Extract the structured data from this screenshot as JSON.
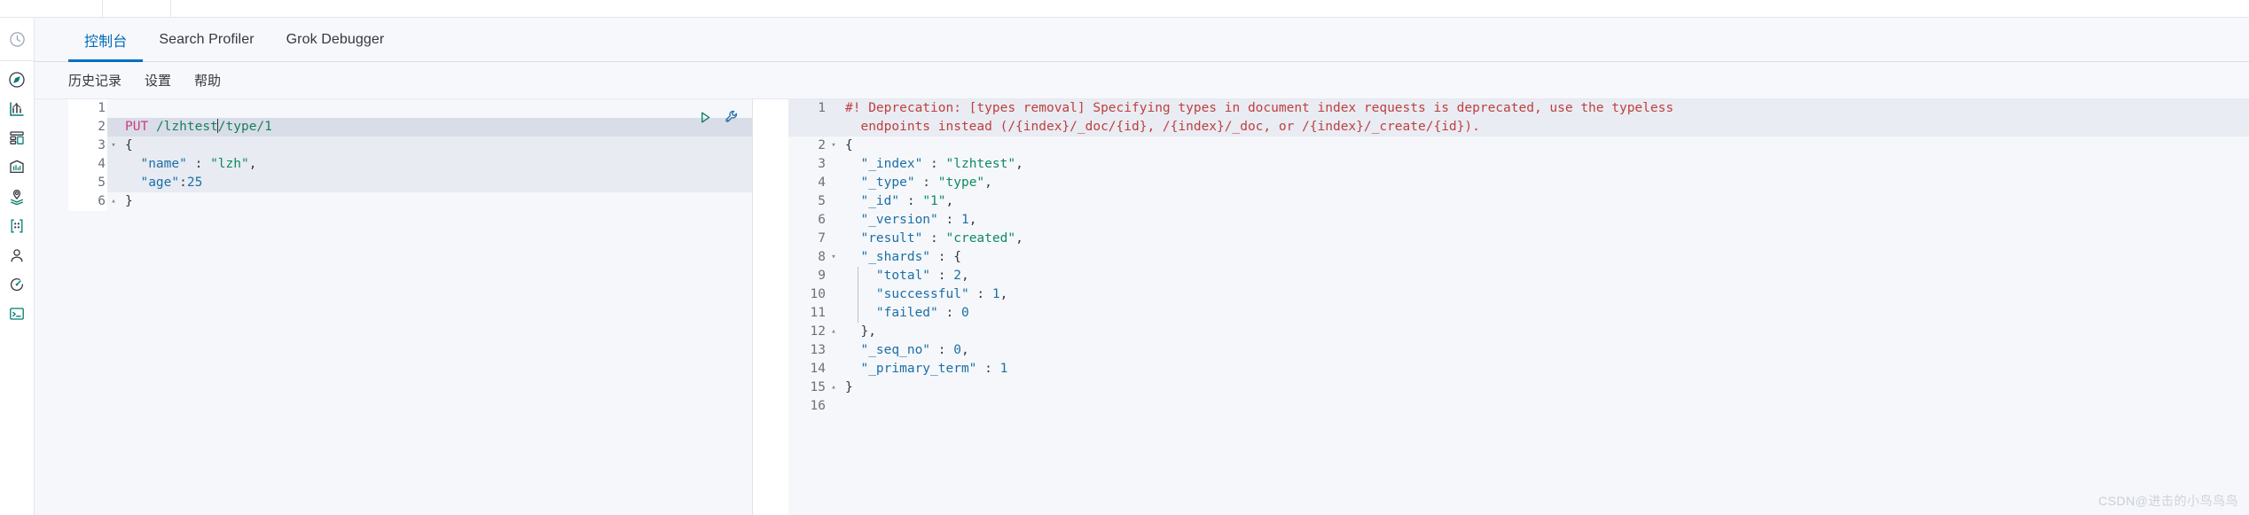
{
  "sidebar": {
    "items": [
      {
        "name": "recently-viewed",
        "icon": "clock-icon"
      },
      {
        "name": "discover",
        "icon": "compass-icon"
      },
      {
        "name": "visualize",
        "icon": "chart-icon"
      },
      {
        "name": "dashboard",
        "icon": "dashboard-icon"
      },
      {
        "name": "canvas",
        "icon": "canvas-icon"
      },
      {
        "name": "maps",
        "icon": "map-pin-layers-icon"
      },
      {
        "name": "machine-learning",
        "icon": "ml-nodes-icon"
      },
      {
        "name": "infrastructure",
        "icon": "user-icon"
      },
      {
        "name": "apm",
        "icon": "apm-icon"
      },
      {
        "name": "dev-tools",
        "icon": "wrench-terminal-icon"
      }
    ]
  },
  "tabs": [
    {
      "label": "控制台",
      "active": true
    },
    {
      "label": "Search Profiler",
      "active": false
    },
    {
      "label": "Grok Debugger",
      "active": false
    }
  ],
  "menu": [
    {
      "label": "历史记录"
    },
    {
      "label": "设置"
    },
    {
      "label": "帮助"
    }
  ],
  "editor": {
    "actions": {
      "run_label": "▷",
      "wrench_label": "wrench"
    },
    "lines": [
      {
        "num": "1",
        "fold": "",
        "tokens": []
      },
      {
        "num": "2",
        "fold": "",
        "highlight": "hl",
        "tokens": [
          {
            "c": "t-method",
            "t": "PUT"
          },
          {
            "c": "t-punc",
            "t": " "
          },
          {
            "c": "t-url",
            "t": "/lzhtest"
          },
          {
            "c": "caret",
            "t": ""
          },
          {
            "c": "t-url",
            "t": "/type/1"
          }
        ]
      },
      {
        "num": "3",
        "fold": "▾",
        "highlight": "hl-soft",
        "tokens": [
          {
            "c": "t-brace",
            "t": "{"
          }
        ]
      },
      {
        "num": "4",
        "fold": "",
        "highlight": "hl-soft",
        "tokens": [
          {
            "c": "t-punc",
            "t": "  "
          },
          {
            "c": "t-key",
            "t": "\"name\""
          },
          {
            "c": "t-punc",
            "t": " : "
          },
          {
            "c": "t-str",
            "t": "\"lzh\""
          },
          {
            "c": "t-punc",
            "t": ","
          }
        ]
      },
      {
        "num": "5",
        "fold": "",
        "highlight": "hl-soft",
        "tokens": [
          {
            "c": "t-punc",
            "t": "  "
          },
          {
            "c": "t-key",
            "t": "\"age\""
          },
          {
            "c": "t-punc",
            "t": ":"
          },
          {
            "c": "t-num",
            "t": "25"
          }
        ]
      },
      {
        "num": "6",
        "fold": "▴",
        "tokens": [
          {
            "c": "t-brace",
            "t": "}"
          }
        ]
      }
    ]
  },
  "response": {
    "lines": [
      {
        "num": "1",
        "fold": "",
        "highlight": "warn",
        "tokens": [
          {
            "c": "t-warn",
            "t": "#! Deprecation: [types removal] Specifying types in document index requests is deprecated, use the typeless"
          }
        ]
      },
      {
        "num": "",
        "fold": "",
        "highlight": "warn",
        "tokens": [
          {
            "c": "t-warn",
            "t": "  endpoints instead (/{index}/_doc/{id}, /{index}/_doc, or /{index}/_create/{id})."
          }
        ]
      },
      {
        "num": "2",
        "fold": "▾",
        "tokens": [
          {
            "c": "t-brace",
            "t": "{"
          }
        ]
      },
      {
        "num": "3",
        "fold": "",
        "tokens": [
          {
            "c": "t-punc",
            "t": "  "
          },
          {
            "c": "t-key",
            "t": "\"_index\""
          },
          {
            "c": "t-punc",
            "t": " : "
          },
          {
            "c": "t-str",
            "t": "\"lzhtest\""
          },
          {
            "c": "t-punc",
            "t": ","
          }
        ]
      },
      {
        "num": "4",
        "fold": "",
        "tokens": [
          {
            "c": "t-punc",
            "t": "  "
          },
          {
            "c": "t-key",
            "t": "\"_type\""
          },
          {
            "c": "t-punc",
            "t": " : "
          },
          {
            "c": "t-str",
            "t": "\"type\""
          },
          {
            "c": "t-punc",
            "t": ","
          }
        ]
      },
      {
        "num": "5",
        "fold": "",
        "tokens": [
          {
            "c": "t-punc",
            "t": "  "
          },
          {
            "c": "t-key",
            "t": "\"_id\""
          },
          {
            "c": "t-punc",
            "t": " : "
          },
          {
            "c": "t-str",
            "t": "\"1\""
          },
          {
            "c": "t-punc",
            "t": ","
          }
        ]
      },
      {
        "num": "6",
        "fold": "",
        "tokens": [
          {
            "c": "t-punc",
            "t": "  "
          },
          {
            "c": "t-key",
            "t": "\"_version\""
          },
          {
            "c": "t-punc",
            "t": " : "
          },
          {
            "c": "t-num",
            "t": "1"
          },
          {
            "c": "t-punc",
            "t": ","
          }
        ]
      },
      {
        "num": "7",
        "fold": "",
        "tokens": [
          {
            "c": "t-punc",
            "t": "  "
          },
          {
            "c": "t-key",
            "t": "\"result\""
          },
          {
            "c": "t-punc",
            "t": " : "
          },
          {
            "c": "t-str",
            "t": "\"created\""
          },
          {
            "c": "t-punc",
            "t": ","
          }
        ]
      },
      {
        "num": "8",
        "fold": "▾",
        "tokens": [
          {
            "c": "t-punc",
            "t": "  "
          },
          {
            "c": "t-key",
            "t": "\"_shards\""
          },
          {
            "c": "t-punc",
            "t": " : "
          },
          {
            "c": "t-brace",
            "t": "{"
          }
        ]
      },
      {
        "num": "9",
        "fold": "",
        "tokens": [
          {
            "c": "t-punc",
            "t": "    "
          },
          {
            "c": "t-key",
            "t": "\"total\""
          },
          {
            "c": "t-punc",
            "t": " : "
          },
          {
            "c": "t-num",
            "t": "2"
          },
          {
            "c": "t-punc",
            "t": ","
          }
        ]
      },
      {
        "num": "10",
        "fold": "",
        "tokens": [
          {
            "c": "t-punc",
            "t": "    "
          },
          {
            "c": "t-key",
            "t": "\"successful\""
          },
          {
            "c": "t-punc",
            "t": " : "
          },
          {
            "c": "t-num",
            "t": "1"
          },
          {
            "c": "t-punc",
            "t": ","
          }
        ]
      },
      {
        "num": "11",
        "fold": "",
        "tokens": [
          {
            "c": "t-punc",
            "t": "    "
          },
          {
            "c": "t-key",
            "t": "\"failed\""
          },
          {
            "c": "t-punc",
            "t": " : "
          },
          {
            "c": "t-num",
            "t": "0"
          }
        ]
      },
      {
        "num": "12",
        "fold": "▴",
        "tokens": [
          {
            "c": "t-punc",
            "t": "  "
          },
          {
            "c": "t-brace",
            "t": "},"
          }
        ]
      },
      {
        "num": "13",
        "fold": "",
        "tokens": [
          {
            "c": "t-punc",
            "t": "  "
          },
          {
            "c": "t-key",
            "t": "\"_seq_no\""
          },
          {
            "c": "t-punc",
            "t": " : "
          },
          {
            "c": "t-num",
            "t": "0"
          },
          {
            "c": "t-punc",
            "t": ","
          }
        ]
      },
      {
        "num": "14",
        "fold": "",
        "tokens": [
          {
            "c": "t-punc",
            "t": "  "
          },
          {
            "c": "t-key",
            "t": "\"_primary_term\""
          },
          {
            "c": "t-punc",
            "t": " : "
          },
          {
            "c": "t-num",
            "t": "1"
          }
        ]
      },
      {
        "num": "15",
        "fold": "▴",
        "tokens": [
          {
            "c": "t-brace",
            "t": "}"
          }
        ]
      },
      {
        "num": "16",
        "fold": "",
        "tokens": []
      }
    ]
  },
  "watermark": {
    "text1": "CSDN",
    "text2": "@进击的小鸟鸟鸟"
  },
  "colors": {
    "accent": "#0071c2",
    "active_tab_text": "#006bb4",
    "warn": "#bd4040",
    "key": "#1b6fa8",
    "string": "#0f8a5f",
    "method": "#d13b7e",
    "url": "#1a7f5a",
    "highlight_row": "#d8dde8"
  }
}
